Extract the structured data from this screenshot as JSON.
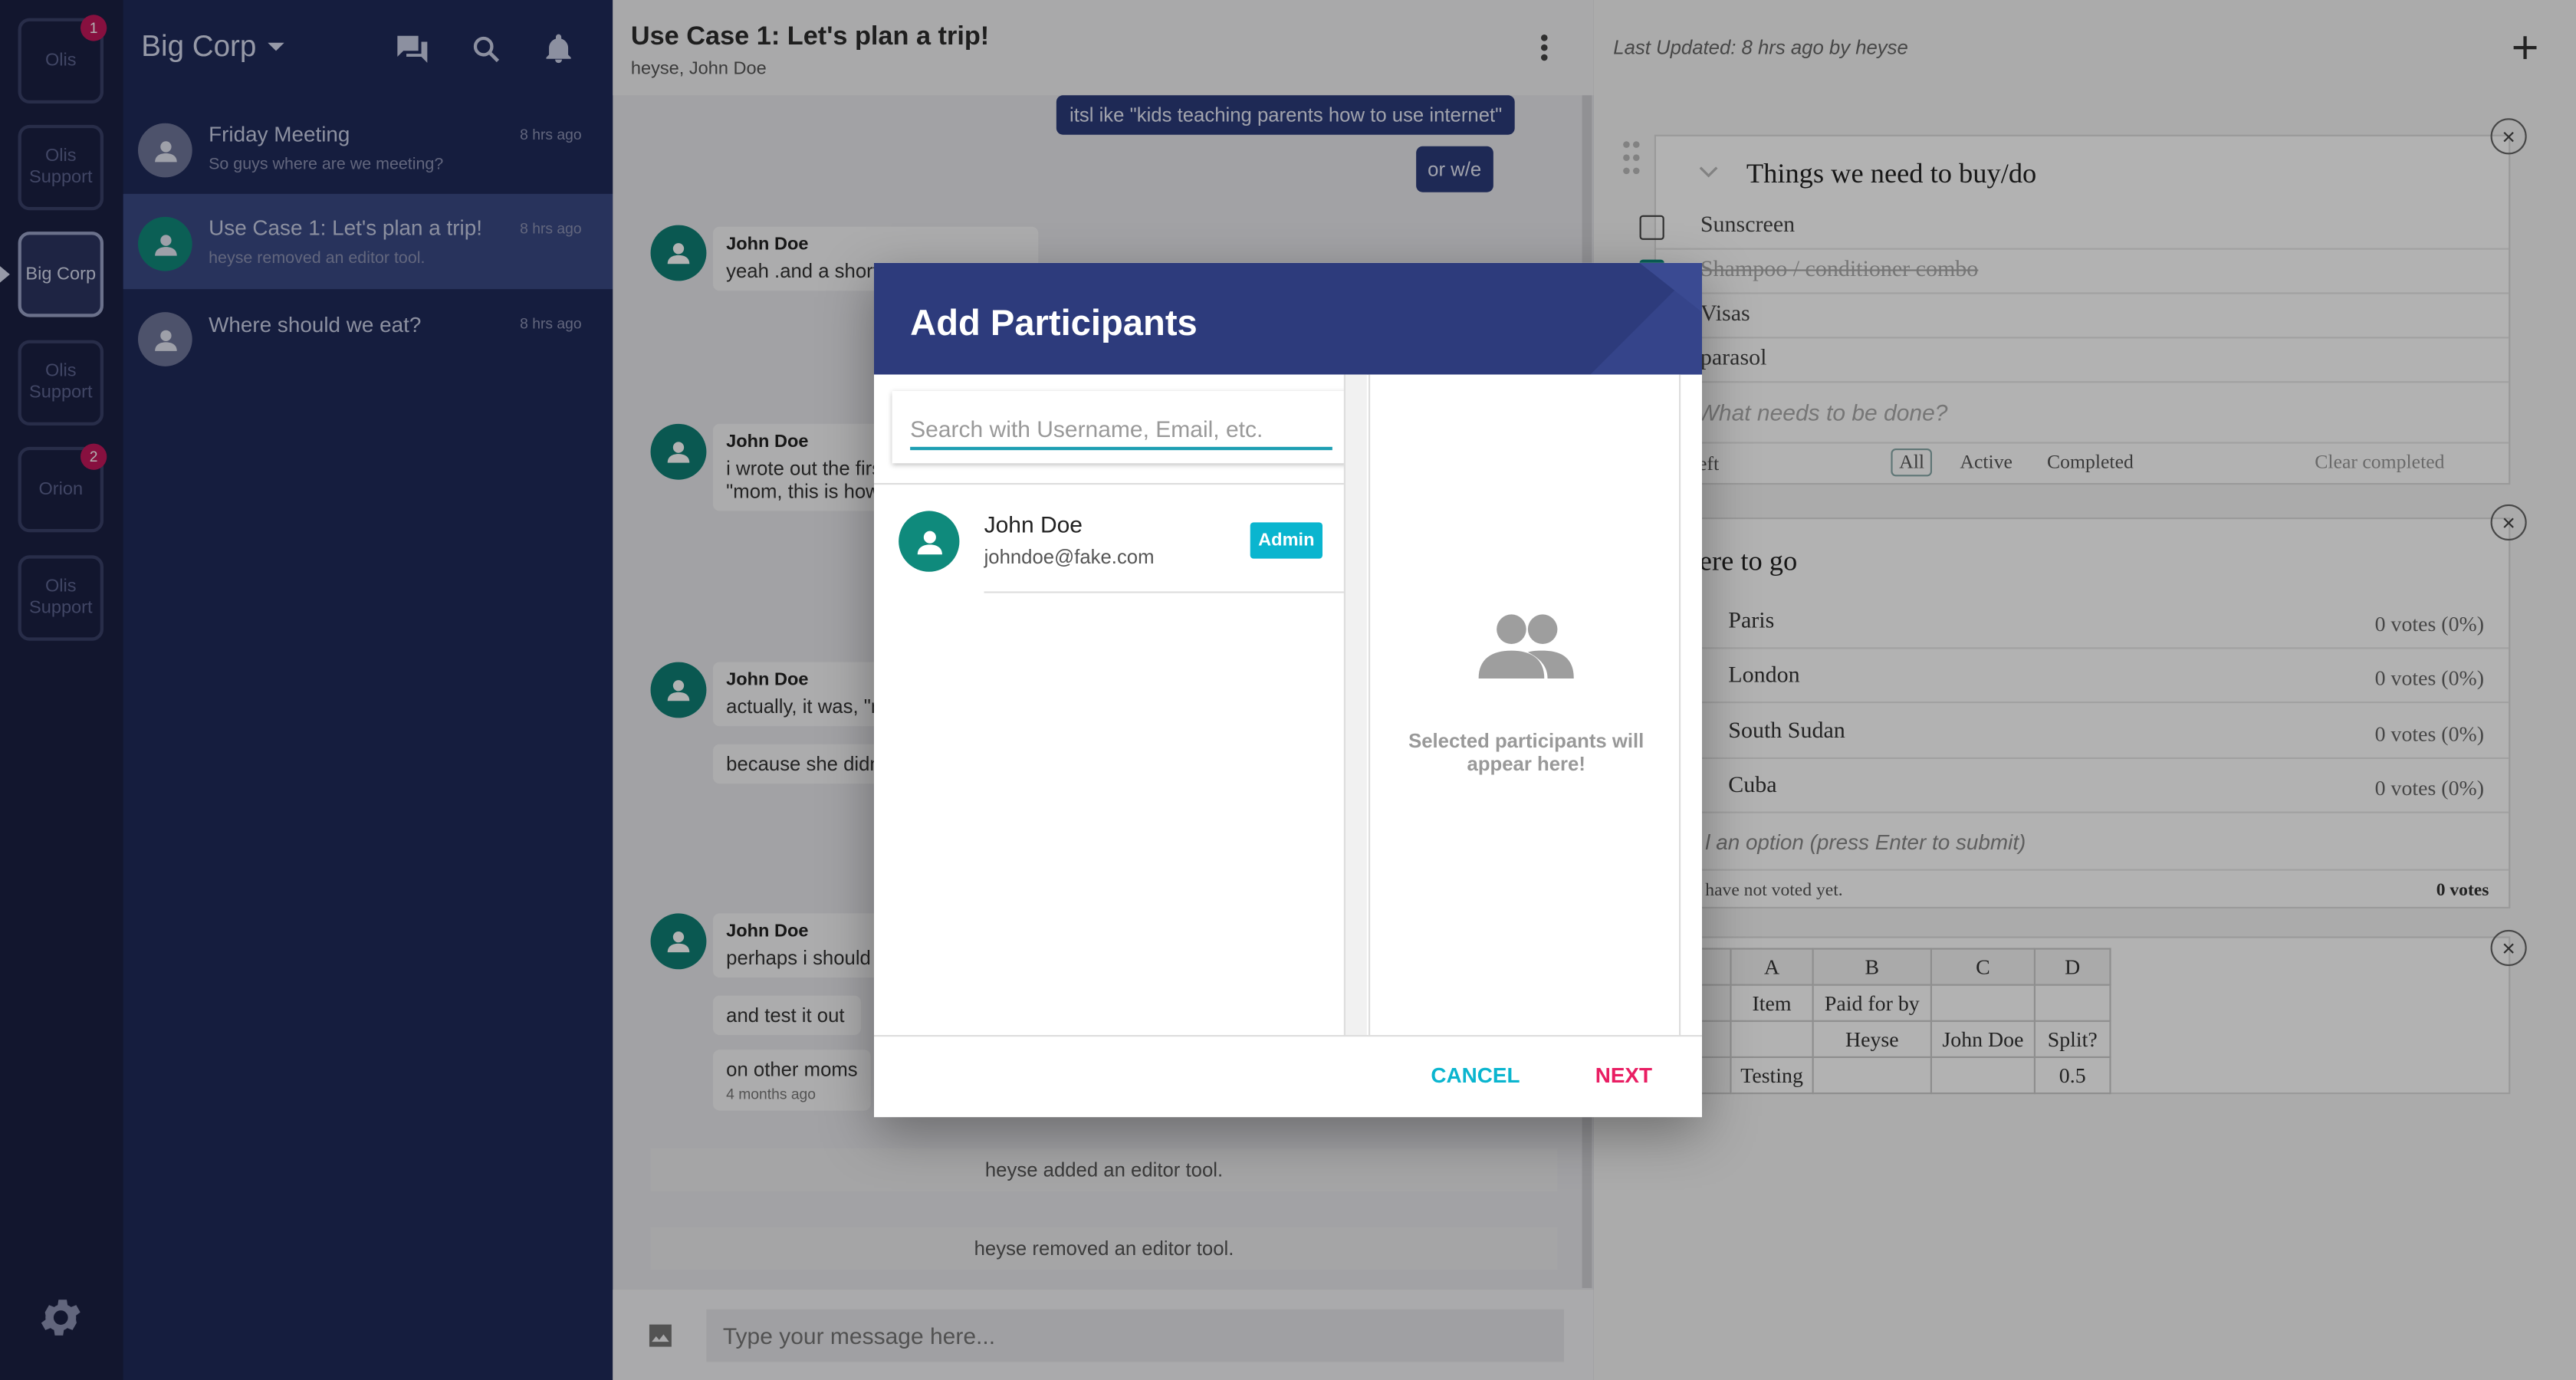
{
  "rail": {
    "workspaces": [
      {
        "label": "Olis",
        "badge": "1"
      },
      {
        "label": "Olis Support",
        "badge": ""
      },
      {
        "label": "Big Corp",
        "badge": ""
      },
      {
        "label": "Olis Support",
        "badge": ""
      },
      {
        "label": "Orion",
        "badge": "2"
      },
      {
        "label": "Olis Support",
        "badge": ""
      }
    ]
  },
  "sidebar": {
    "team_name": "Big Corp",
    "channels": [
      {
        "name": "Friday Meeting",
        "preview": "So guys where are we meeting?",
        "time": "8 hrs ago"
      },
      {
        "name": "Use Case 1: Let's plan a trip!",
        "preview": "heyse removed an editor tool.",
        "time": "8 hrs ago"
      },
      {
        "name": "Where should we eat?",
        "preview": "",
        "time": "8 hrs ago"
      }
    ]
  },
  "chat": {
    "title": "Use Case 1: Let's plan a trip!",
    "members": "heyse, John Doe",
    "my_messages": [
      "itsl ike \"kids teaching parents how to use internet\"",
      "or w/e"
    ],
    "messages": [
      {
        "author": "John Doe",
        "lines": [
          "yeah .and a short"
        ]
      },
      {
        "author": "John Doe",
        "lines": [
          "i wrote out the firs",
          "\"mom, this is how"
        ]
      },
      {
        "author": "John Doe",
        "lines": [
          "actually, it was, \"m"
        ],
        "extra": "because she didn"
      },
      {
        "author": "John Doe",
        "lines": [
          "perhaps i should a"
        ],
        "extra": "and test it out",
        "extra2": "on other moms",
        "time": "4 months ago"
      }
    ],
    "system_messages": [
      "heyse added an editor tool.",
      "heyse removed an editor tool."
    ],
    "composer_placeholder": "Type your message here..."
  },
  "tools": {
    "last_updated": "Last Updated: 8 hrs ago by heyse",
    "todo": {
      "title": "Things we need to buy/do",
      "items": [
        {
          "label": "Sunscreen",
          "done": false
        },
        {
          "label": "Shampoo / conditioner combo",
          "done": true
        },
        {
          "label": "Visas",
          "done": false
        },
        {
          "label": "parasol",
          "done": false
        }
      ],
      "new_placeholder": "What needs to be done?",
      "items_left": "ems left",
      "filters": [
        "All",
        "Active",
        "Completed"
      ],
      "clear": "Clear completed"
    },
    "poll": {
      "title": "here to go",
      "options": [
        {
          "label": "Paris",
          "votes": "0 votes (0%)"
        },
        {
          "label": "London",
          "votes": "0 votes (0%)"
        },
        {
          "label": "South Sudan",
          "votes": "0 votes (0%)"
        },
        {
          "label": "Cuba",
          "votes": "0 votes (0%)"
        }
      ],
      "add_placeholder": "l an option (press Enter to submit)",
      "not_voted": "have not voted yet.",
      "total": "0 votes"
    },
    "sheet": {
      "columns": [
        "A",
        "B",
        "C",
        "D"
      ],
      "rows": [
        [
          "Item",
          "Paid for by",
          "",
          ""
        ],
        [
          "",
          "Heyse",
          "John Doe",
          "Split?"
        ],
        [
          "Testing",
          "",
          "",
          "0.5"
        ]
      ]
    }
  },
  "modal": {
    "title": "Add Participants",
    "search_placeholder": "Search with Username, Email, etc.",
    "user": {
      "name": "John Doe",
      "email": "johndoe@fake.com",
      "badge": "Admin"
    },
    "empty_text": "Selected participants will appear here!",
    "cancel": "CANCEL",
    "next": "NEXT"
  },
  "colors": {
    "modal_header": "#2d3b7c",
    "accent_cyan": "#0ab5cf",
    "accent_pink": "#e91e63",
    "avatar_teal": "#0f8a7c"
  }
}
